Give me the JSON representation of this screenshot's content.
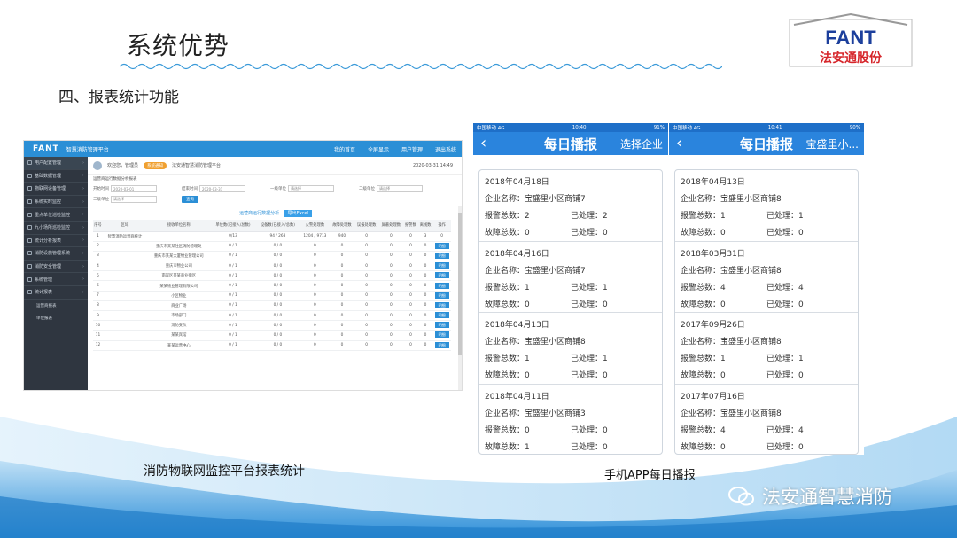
{
  "slide": {
    "title": "系统优势",
    "subtitle": "四、报表统计功能",
    "logo_text": "FANT",
    "logo_sub": "法安通股份",
    "caption_left": "消防物联网监控平台报表统计",
    "caption_right": "手机APP每日播报",
    "watermark": "法安通智慧消防"
  },
  "desktop": {
    "brand": "FANT",
    "app_name": "智慧消防管理平台",
    "top_links": [
      "我的首页",
      "全屏显示",
      "用户管理",
      "退出系统"
    ],
    "sidebar": [
      {
        "label": "用户配置管理",
        "active": true
      },
      {
        "label": "基础数据管理"
      },
      {
        "label": "物联网设备管理"
      },
      {
        "label": "系统实时监控"
      },
      {
        "label": "重点单位巡检监控"
      },
      {
        "label": "九小场所巡检监控"
      },
      {
        "label": "统计分析报表"
      },
      {
        "label": "消防设施管理系统"
      },
      {
        "label": "消防安全管理"
      },
      {
        "label": "系统管理"
      },
      {
        "label": "统计报表"
      }
    ],
    "sidebar_sub": [
      "运营商报表",
      "单位报表"
    ],
    "welcome": "欢迎您，管理员",
    "tag": "系统通知",
    "notice": "法安通智慧消防管理平台",
    "time": "2020-03-31 14:49",
    "crumb": "运营商运行数据分析报表",
    "filters": [
      {
        "label": "开始时间",
        "value": "2020-03-01"
      },
      {
        "label": "结束时间",
        "value": "2020-03-31"
      },
      {
        "label": "一级单位",
        "value": "请选择"
      },
      {
        "label": "二级单位",
        "value": "请选择"
      },
      {
        "label": "三级单位",
        "value": "请选择"
      }
    ],
    "search_btn": "查询",
    "table_title": "运营商运行数据分析",
    "export_btn": "导出Excel",
    "columns": [
      "序号",
      "区域",
      "接收单位名称",
      "单位数(已接入/总数)",
      "设备数(已接入/总数)",
      "火警处理数",
      "故障处理数",
      "误报处理数",
      "屏蔽处理数",
      "报警数",
      "离线数",
      "操作"
    ],
    "rows": [
      [
        "1",
        "智慧消防运营商统计",
        "",
        "0/13",
        "94 / 268",
        "1204 / 9713",
        "940",
        "0",
        "0",
        "0",
        "3",
        "0"
      ],
      [
        "2",
        "",
        "重庆市某某社区消防管理处",
        "0 / 1",
        "0 / 0",
        "0",
        "0",
        "0",
        "0",
        "0",
        "0",
        "明细"
      ],
      [
        "3",
        "",
        "重庆市某某大厦物业管理公司",
        "0 / 1",
        "0 / 0",
        "0",
        "0",
        "0",
        "0",
        "0",
        "0",
        "明细"
      ],
      [
        "4",
        "",
        "重庆市物业公司",
        "0 / 1",
        "0 / 0",
        "0",
        "0",
        "0",
        "0",
        "0",
        "0",
        "明细"
      ],
      [
        "5",
        "",
        "南岸区某某商业街区",
        "0 / 1",
        "0 / 0",
        "0",
        "0",
        "0",
        "0",
        "0",
        "0",
        "明细"
      ],
      [
        "6",
        "",
        "某某物业管理有限公司",
        "0 / 1",
        "0 / 0",
        "0",
        "0",
        "0",
        "0",
        "0",
        "0",
        "明细"
      ],
      [
        "7",
        "",
        "小区物业",
        "0 / 1",
        "0 / 0",
        "0",
        "0",
        "0",
        "0",
        "0",
        "0",
        "明细"
      ],
      [
        "8",
        "",
        "商业广场",
        "0 / 1",
        "0 / 0",
        "0",
        "0",
        "0",
        "0",
        "0",
        "0",
        "明细"
      ],
      [
        "9",
        "",
        "市场部门",
        "0 / 1",
        "0 / 0",
        "0",
        "0",
        "0",
        "0",
        "0",
        "0",
        "明细"
      ],
      [
        "10",
        "",
        "消防支队",
        "0 / 1",
        "0 / 0",
        "0",
        "0",
        "0",
        "0",
        "0",
        "0",
        "明细"
      ],
      [
        "11",
        "",
        "某某宾馆",
        "0 / 1",
        "0 / 0",
        "0",
        "0",
        "0",
        "0",
        "0",
        "0",
        "明细"
      ],
      [
        "12",
        "",
        "某某运营中心",
        "0 / 1",
        "0 / 0",
        "0",
        "0",
        "0",
        "0",
        "0",
        "0",
        "明细"
      ]
    ]
  },
  "phone1": {
    "carrier": "中国移动 4G",
    "time": "10:40",
    "battery": "91%",
    "title": "每日播报",
    "right": "选择企业",
    "cards": [
      {
        "date": "2018年04月18日",
        "company": "企业名称：宝盛里小区商铺7",
        "alarm": "报警总数：2",
        "handled": "已处理：2",
        "fault": "故障总数：0",
        "fhandled": "已处理：0"
      },
      {
        "date": "2018年04月16日",
        "company": "企业名称：宝盛里小区商铺7",
        "alarm": "报警总数：1",
        "handled": "已处理：1",
        "fault": "故障总数：0",
        "fhandled": "已处理：0"
      },
      {
        "date": "2018年04月13日",
        "company": "企业名称：宝盛里小区商铺8",
        "alarm": "报警总数：1",
        "handled": "已处理：1",
        "fault": "故障总数：0",
        "fhandled": "已处理：0"
      },
      {
        "date": "2018年04月11日",
        "company": "企业名称：宝盛里小区商铺3",
        "alarm": "报警总数：0",
        "handled": "已处理：0",
        "fault": "故障总数：1",
        "fhandled": "已处理：0"
      }
    ]
  },
  "phone2": {
    "carrier": "中国移动 4G",
    "time": "10:41",
    "battery": "90%",
    "title": "每日播报",
    "right": "宝盛里小...",
    "cards": [
      {
        "date": "2018年04月13日",
        "company": "企业名称：宝盛里小区商铺8",
        "alarm": "报警总数：1",
        "handled": "已处理：1",
        "fault": "故障总数：0",
        "fhandled": "已处理：0"
      },
      {
        "date": "2018年03月31日",
        "company": "企业名称：宝盛里小区商铺8",
        "alarm": "报警总数：4",
        "handled": "已处理：4",
        "fault": "故障总数：0",
        "fhandled": "已处理：0"
      },
      {
        "date": "2017年09月26日",
        "company": "企业名称：宝盛里小区商铺8",
        "alarm": "报警总数：1",
        "handled": "已处理：1",
        "fault": "故障总数：0",
        "fhandled": "已处理：0"
      },
      {
        "date": "2017年07月16日",
        "company": "企业名称：宝盛里小区商铺8",
        "alarm": "报警总数：4",
        "handled": "已处理：4",
        "fault": "故障总数：0",
        "fhandled": "已处理：0"
      }
    ]
  },
  "colors": {
    "accent": "#2a84dd",
    "sidebar": "#2f3640",
    "logo_red": "#d6262b",
    "logo_blue": "#1c3f9c"
  }
}
